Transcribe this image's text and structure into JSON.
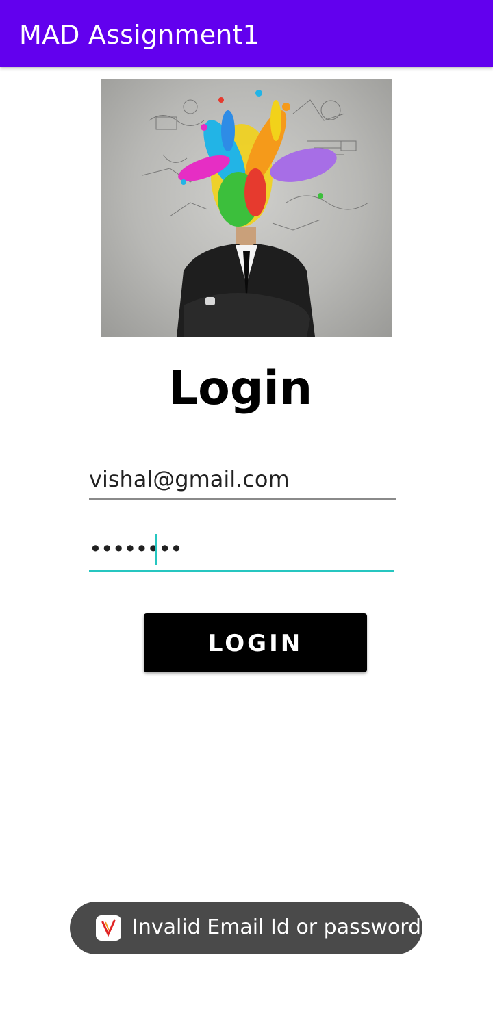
{
  "app_bar": {
    "title": "MAD Assignment1",
    "color": "#6200EE"
  },
  "hero_image": {
    "icon": "creative-businessman-paint-splash-image"
  },
  "login_form": {
    "heading": "Login",
    "email_value": "vishal@gmail.com",
    "password_masked": "••••••••",
    "focus_color": "#26C6C0",
    "button_label": "LOGIN"
  },
  "toast": {
    "icon": "app-logo-icon",
    "message": "Invalid Email Id or password"
  }
}
